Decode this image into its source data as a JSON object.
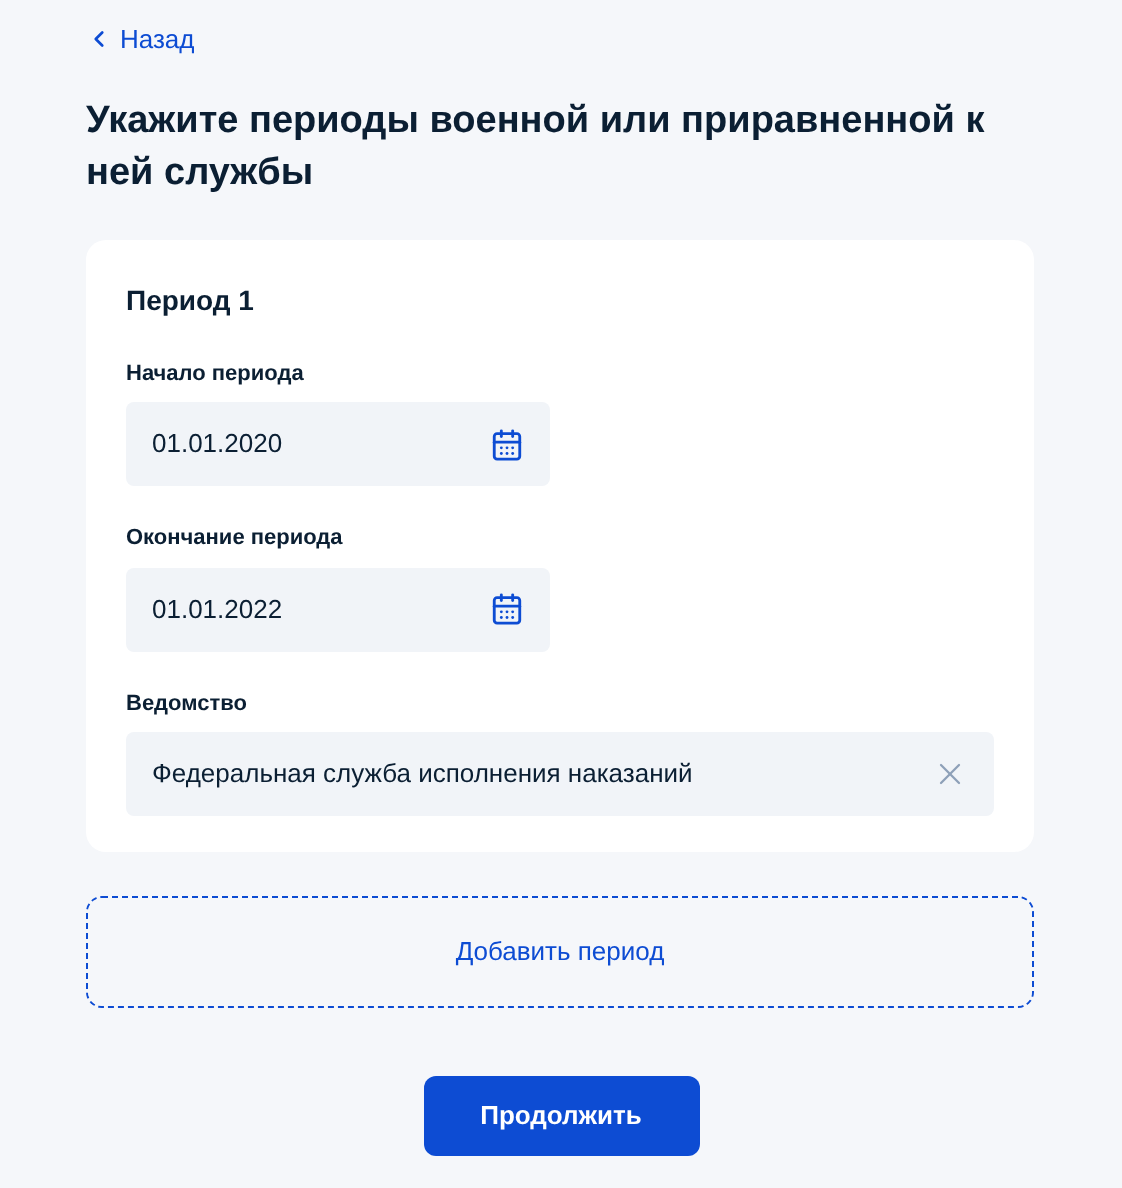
{
  "back_link": "Назад",
  "title": "Укажите периоды военной или приравненной к ней службы",
  "periods": [
    {
      "heading": "Период 1",
      "fields": [
        {
          "kind": "date",
          "label": "Начало периода",
          "value": "01.01.2020"
        },
        {
          "kind": "date",
          "label": "Окончание периода",
          "value": "01.01.2022"
        },
        {
          "kind": "select",
          "label": "Ведомство",
          "value": "Федеральная служба исполнения наказаний"
        }
      ]
    }
  ],
  "add_button": "Добавить период",
  "continue_button": "Продолжить"
}
